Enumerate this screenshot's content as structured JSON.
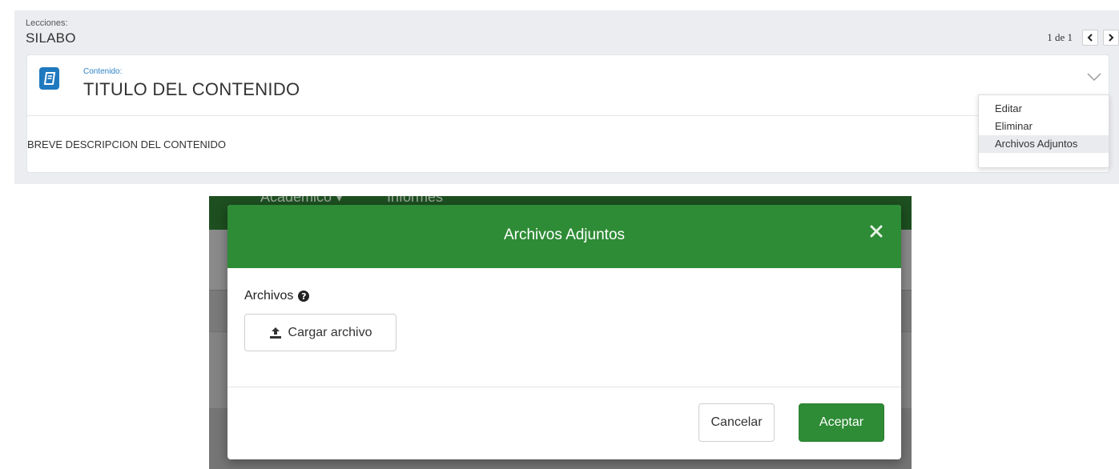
{
  "lessons": {
    "label": "Lecciones:",
    "title": "SILABO",
    "pager": {
      "text": "1 de 1"
    }
  },
  "content_card": {
    "label": "Contenido:",
    "title": "TITULO DEL CONTENIDO",
    "description": "BREVE DESCRIPCION DEL CONTENIDO",
    "icon": "book-icon"
  },
  "dropdown": {
    "items": [
      {
        "label": "Editar"
      },
      {
        "label": "Eliminar"
      },
      {
        "label": "Archivos Adjuntos",
        "active": true
      }
    ]
  },
  "background_nav": {
    "items": [
      "Académico ▾",
      "Informes"
    ]
  },
  "modal": {
    "title": "Archivos Adjuntos",
    "field_label": "Archivos",
    "help_icon": "?",
    "upload_label": "Cargar archivo",
    "cancel_label": "Cancelar",
    "accept_label": "Aceptar"
  },
  "colors": {
    "primary_green": "#2e8b36",
    "accent_blue": "#1f79bf",
    "panel_gray": "#ebedf0"
  }
}
